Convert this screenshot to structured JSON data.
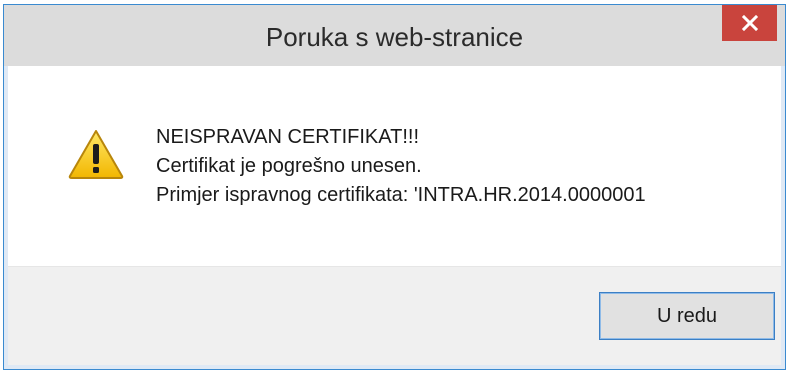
{
  "top_cutoff_text": "(......) ...... ............",
  "dialog": {
    "title": "Poruka s web-stranice",
    "close_glyph": "✕",
    "icon": "warning-icon",
    "message_lines": [
      "NEISPRAVAN CERTIFIKAT!!!",
      "Certifikat je pogrešno unesen.",
      "Primjer ispravnog certifikata: 'INTRA.HR.2014.0000001"
    ],
    "ok_label": "U redu"
  },
  "colors": {
    "titlebar": "#dcdcdc",
    "close_button": "#c9443d",
    "border": "#3a8ad0",
    "footer": "#f0f0f0",
    "ok_button_border": "#3c7fc4"
  }
}
